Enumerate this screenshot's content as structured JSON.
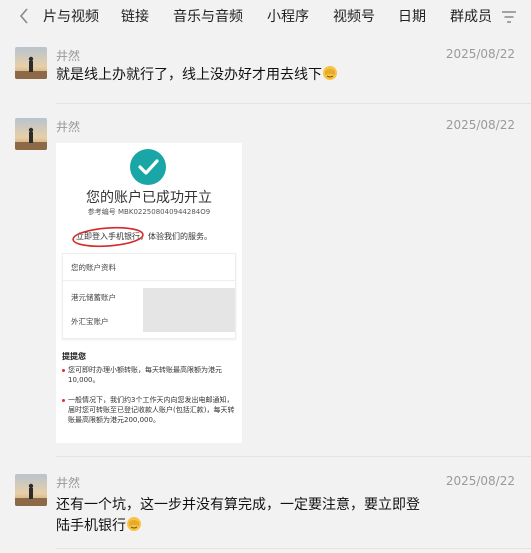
{
  "tabs": {
    "items": [
      "片与视频",
      "链接",
      "音乐与音频",
      "小程序",
      "视频号",
      "日期",
      "群成员"
    ],
    "active_color": "#222222"
  },
  "messages": [
    {
      "sender": "井然",
      "time": "2025/08/22",
      "text": "就是线上办就行了，线上没办好才用去线下",
      "emoji": "facepalm-emoji"
    },
    {
      "sender": "井然",
      "time": "2025/08/22",
      "image": {
        "title": "您的账户已成功开立",
        "reference": "参考编号 MBK022508040944284O9",
        "login_text": "立即登入手机银行，体验我们的服务。",
        "card_title": "您的账户资料",
        "row1": "港元储蓄账户",
        "row2": "外汇宝账户",
        "tips_title": "提提您",
        "tip1": "您可即时办理小额转账，每天转账最高限额为港元10,000。",
        "tip2": "一般情况下，我们约3个工作天内向您发出电邮通知，届时您可转账至已登记收款人账户(包括汇款)，每天转账最高限额为港元200,000。",
        "accent": "#1aa6a6"
      }
    },
    {
      "sender": "井然",
      "time": "2025/08/22",
      "text_line1": "还有一个坑，这一步并没有算完成，一定要注意，要立即登",
      "text_line2": "陆手机银行",
      "emoji": "facepalm-emoji"
    }
  ]
}
